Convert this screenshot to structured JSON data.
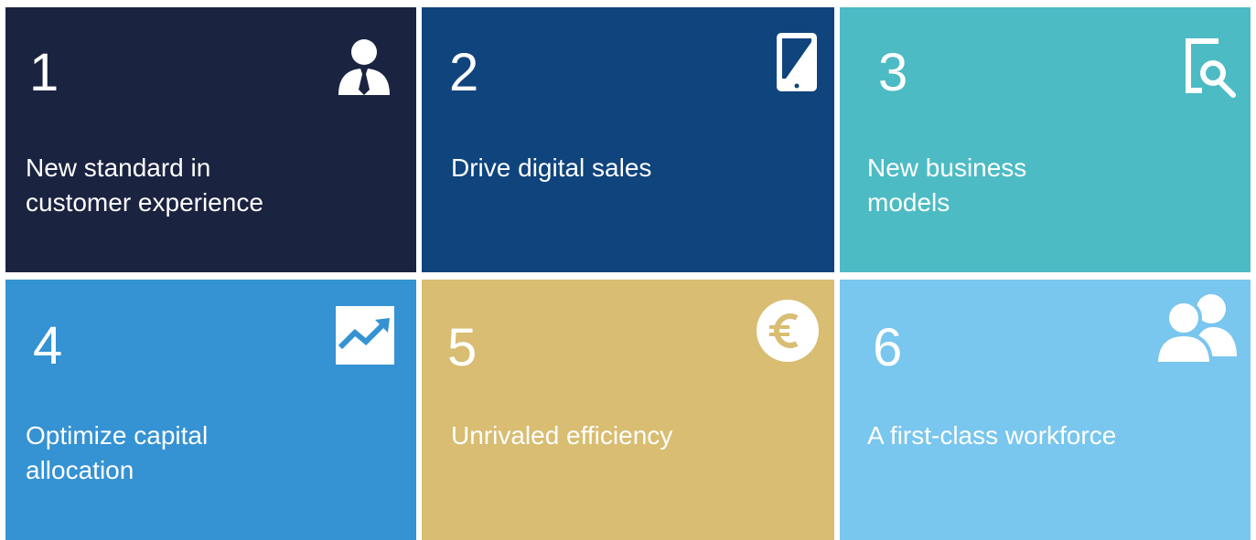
{
  "tiles": [
    {
      "number": "1",
      "title": "New standard in\ncustomer experience",
      "icon": "person-tie-icon",
      "color": "#1a2340"
    },
    {
      "number": "2",
      "title": "Drive digital sales",
      "icon": "tablet-icon",
      "color": "#0f447d"
    },
    {
      "number": "3",
      "title": "New business\nmodels",
      "icon": "document-search-icon",
      "color": "#4dbbc4"
    },
    {
      "number": "4",
      "title": "Optimize capital\nallocation",
      "icon": "trend-chart-icon",
      "color": "#3592d3"
    },
    {
      "number": "5",
      "title": "Unrivaled efficiency",
      "icon": "euro-coin-icon",
      "color": "#d8bd72"
    },
    {
      "number": "6",
      "title": "A first-class workforce",
      "icon": "people-icon",
      "color": "#79c6ee"
    }
  ]
}
